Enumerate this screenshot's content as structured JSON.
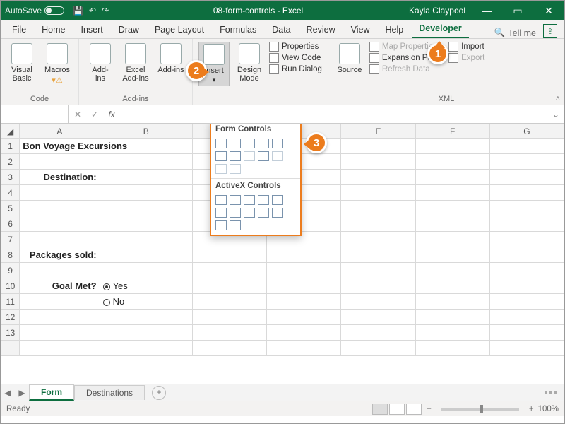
{
  "title": {
    "autosave": "AutoSave",
    "doc": "08-form-controls - Excel",
    "user": "Kayla Claypool"
  },
  "tabs": [
    "File",
    "Home",
    "Insert",
    "Draw",
    "Page Layout",
    "Formulas",
    "Data",
    "Review",
    "View",
    "Help",
    "Developer"
  ],
  "search": "Tell me",
  "groups": {
    "code": {
      "label": "Code",
      "vb": "Visual\nBasic",
      "macros": "Macros"
    },
    "addins": {
      "label": "Add-ins",
      "a1": "Add-\nins",
      "a2": "Excel\nAdd-ins",
      "a3": "Add-ins"
    },
    "controls": {
      "insert": "Insert",
      "design": "Design\nMode",
      "p1": "Properties",
      "p2": "View Code",
      "p3": "Run Dialog"
    },
    "xml": {
      "label": "XML",
      "src": "Source",
      "m1": "Map Properties",
      "m2": "Expansion Packs",
      "m3": "Refresh Data",
      "m4": "Import",
      "m5": "Export"
    }
  },
  "popup": {
    "h1": "Form Controls",
    "h2": "ActiveX Controls"
  },
  "cells": {
    "a1": "Bon Voyage Excursions",
    "a3": "Destination:",
    "a8": "Packages sold:",
    "a10": "Goal Met?",
    "b10": "Yes",
    "b11": "No"
  },
  "cols": [
    "A",
    "B",
    "",
    "",
    "E",
    "F",
    "G"
  ],
  "sheets": {
    "s1": "Form",
    "s2": "Destinations"
  },
  "status": {
    "ready": "Ready",
    "zoom": "100%"
  },
  "callouts": {
    "c1": "1",
    "c2": "2",
    "c3": "3"
  }
}
